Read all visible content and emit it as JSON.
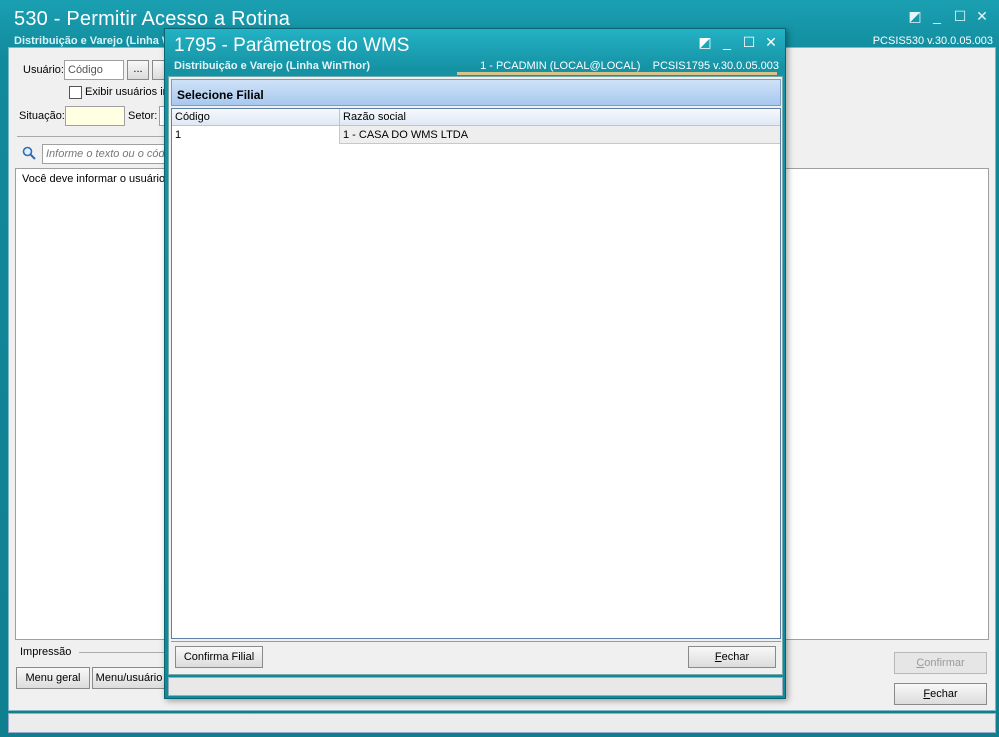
{
  "background_window": {
    "title": "530 - Permitir Acesso a Rotina",
    "subtitle": "Distribuição e Varejo (Linha WinThor)",
    "version": "PCSIS530  v.30.0.05.003",
    "usuario_label": "Usuário:",
    "usuario_placeholder": "Código",
    "ellipsis_button": "...",
    "exibir_label": "Exibir usuários in",
    "situacao_label": "Situação:",
    "setor_label": "Setor:",
    "search_placeholder": "Informe o texto ou o cód",
    "info_text": "Você deve informar o usuário",
    "impressao_label": "Impressão",
    "menu_geral_button": "Menu geral",
    "menu_usuario_button": "Menu/usuário",
    "confirmar_button": "Confirmar",
    "fechar_button": "Fechar"
  },
  "modal": {
    "title": "1795 - Parâmetros do WMS",
    "subtitle": "Distribuição e Varejo (Linha WinThor)",
    "session": "1 - PCADMIN (LOCAL@LOCAL)",
    "version": "PCSIS1795  v.30.0.05.003",
    "section_title": "Selecione Filial",
    "grid": {
      "columns": [
        "Código",
        "Razão social"
      ],
      "rows": [
        {
          "codigo": "1",
          "razao_social": "1 - CASA DO WMS LTDA"
        }
      ]
    },
    "confirma_button": "Confirma Filial",
    "fechar_button": "Fechar"
  },
  "icons": {
    "restore": "restore-icon",
    "minimize": "minimize-icon",
    "maximize": "maximize-icon",
    "close": "close-icon",
    "search": "search-icon"
  },
  "colors": {
    "titlebar": "#1592a4",
    "grid_header": "#a8c8ee"
  }
}
